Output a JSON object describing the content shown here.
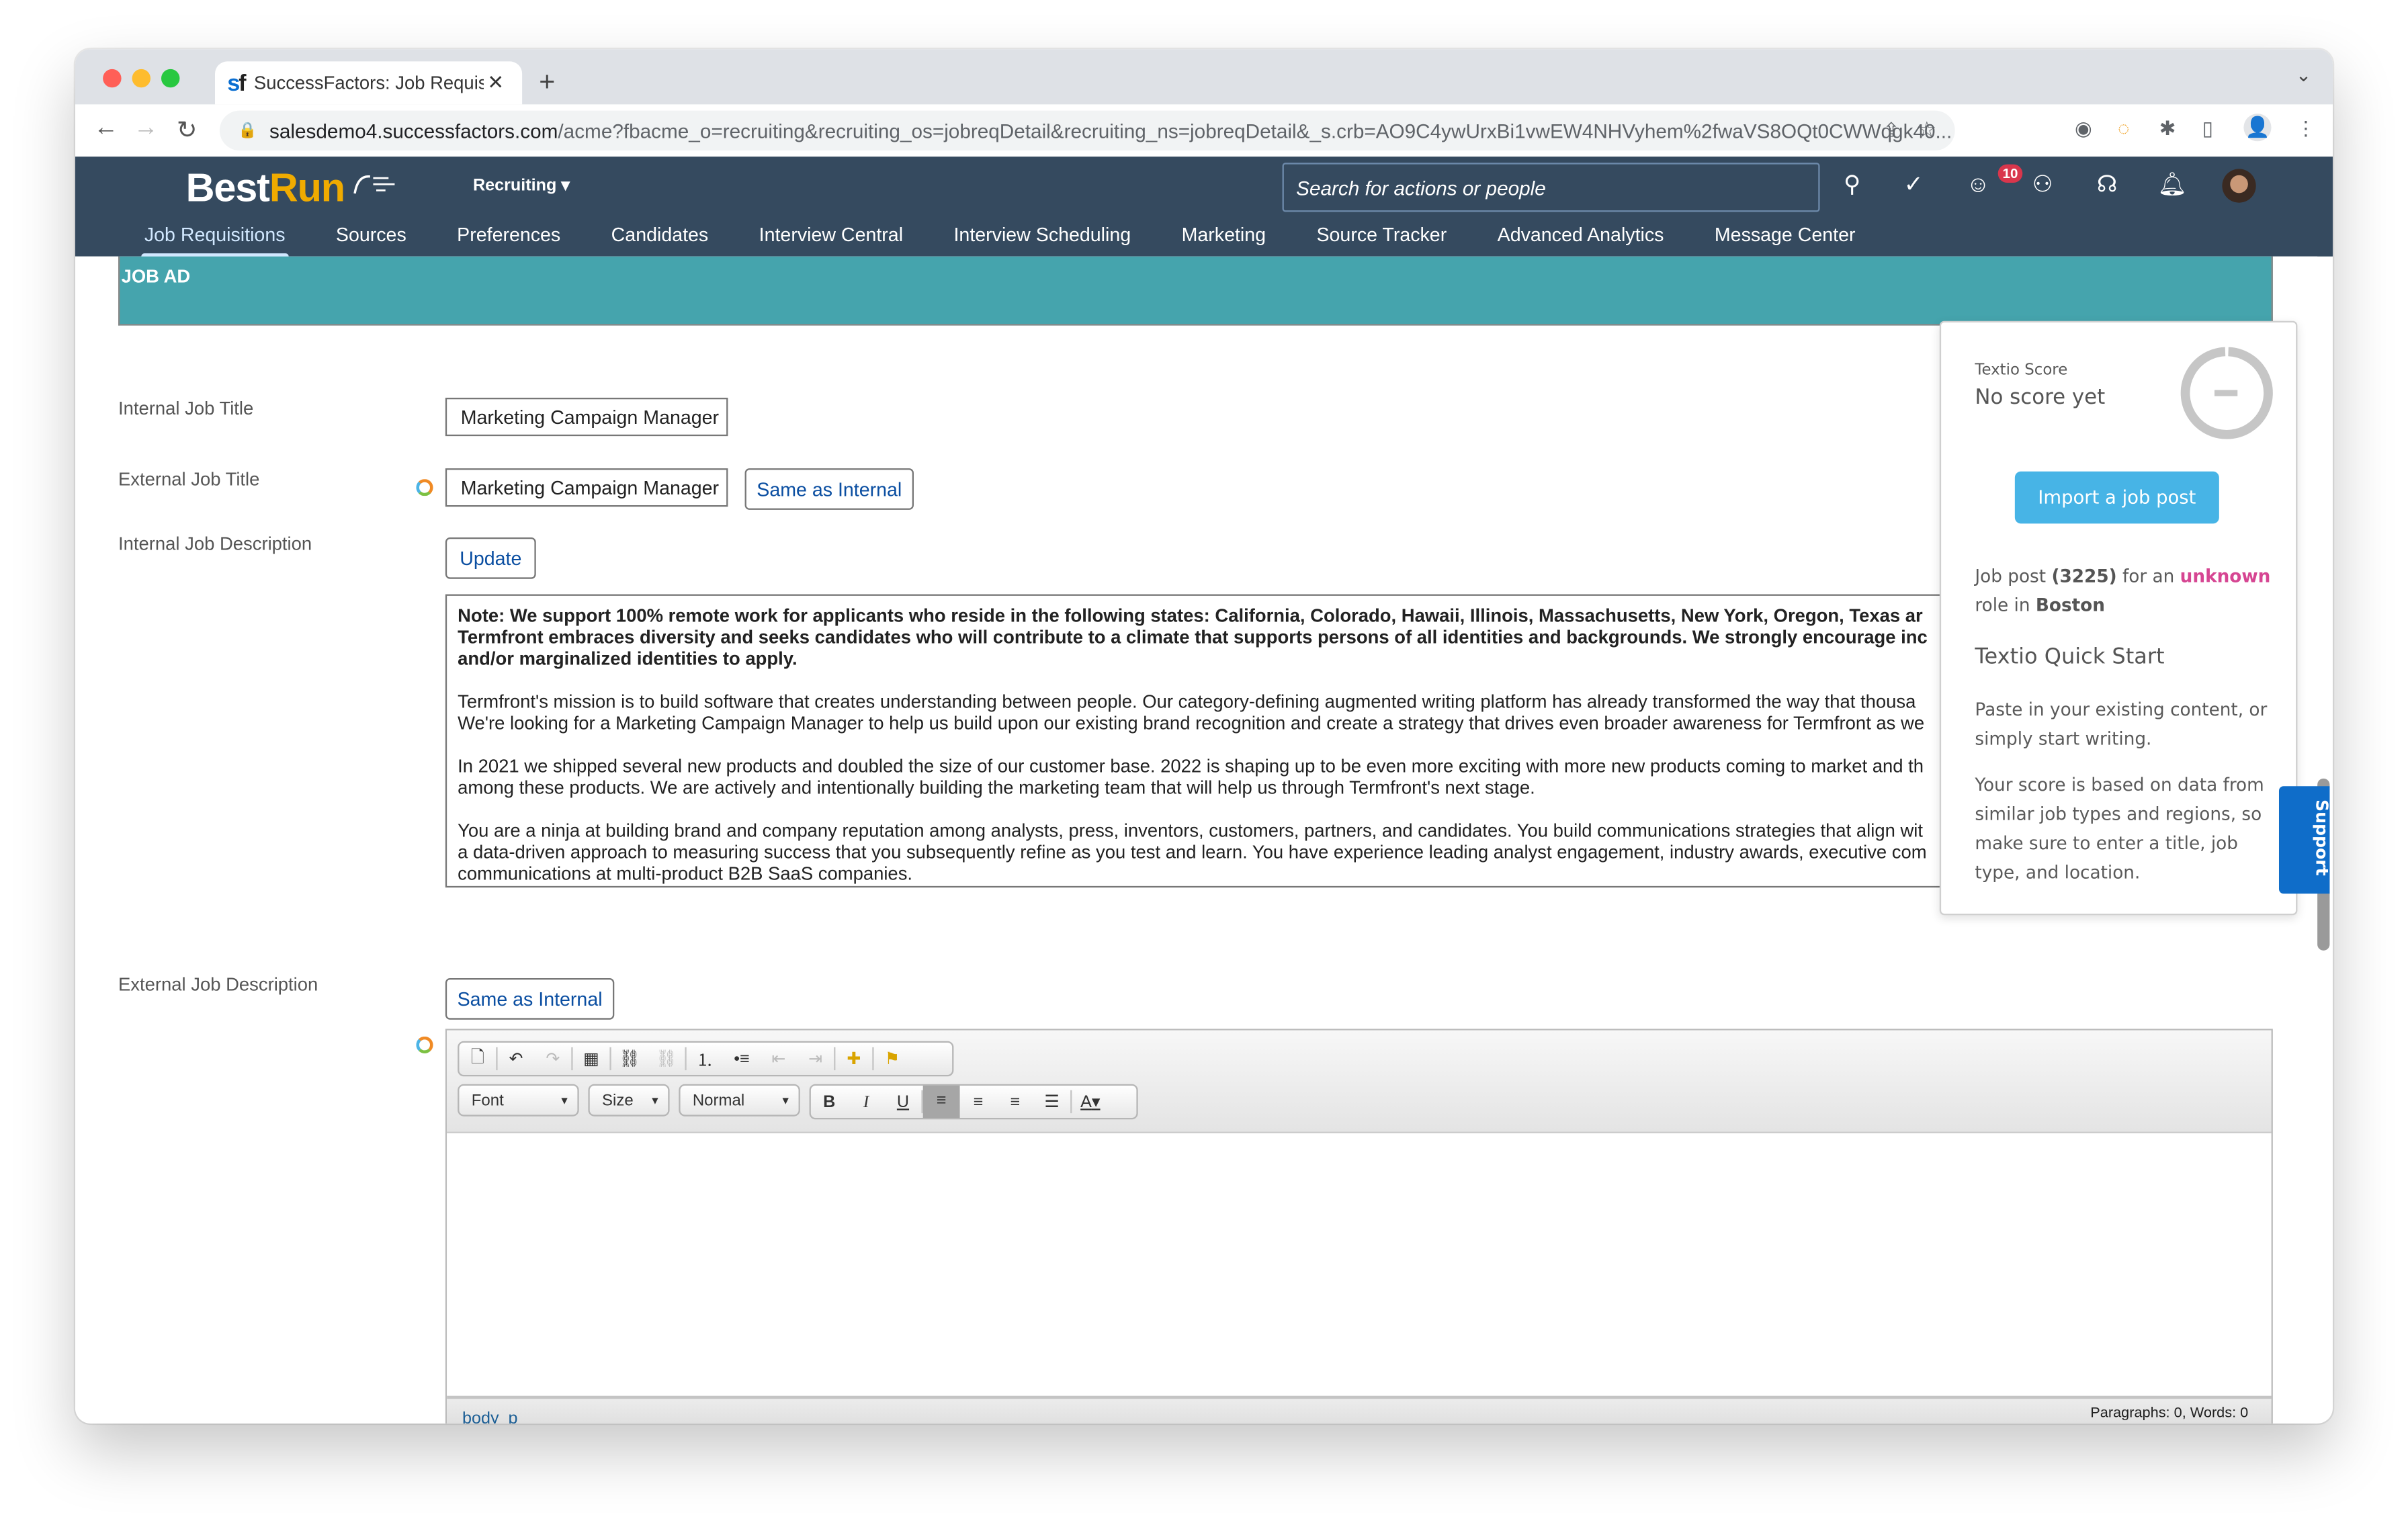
{
  "browser": {
    "tab_title": "SuccessFactors: Job Requisitio",
    "tab_favicon": "sf",
    "url_host": "salesdemo4.successfactors.com",
    "url_path": "/acme?fbacme_o=recruiting&recruiting_os=jobreqDetail&recruiting_ns=jobreqDetail&_s.crb=AO9C4ywUrxBi1vwEW4NHVyhem%2fwaVS8OQt0CWWqgk40..."
  },
  "header": {
    "logo_main": "Best",
    "logo_accent": "Run",
    "module": "Recruiting",
    "search_placeholder": "Search for actions or people",
    "todo_badge": "10",
    "nav": [
      "Job Requisitions",
      "Sources",
      "Preferences",
      "Candidates",
      "Interview Central",
      "Interview Scheduling",
      "Marketing",
      "Source Tracker",
      "Advanced Analytics",
      "Message Center"
    ],
    "active_nav": "Job Requisitions"
  },
  "section": {
    "title": "JOB AD"
  },
  "form": {
    "internal_title_label": "Internal Job Title",
    "internal_title_value": "Marketing Campaign Manager",
    "external_title_label": "External Job Title",
    "external_title_value": "Marketing Campaign Manager",
    "same_as_internal": "Same as Internal",
    "internal_desc_label": "Internal Job Description",
    "update": "Update",
    "internal_desc_paragraphs": [
      {
        "bold": true,
        "lines": [
          "Note: We support 100% remote work for applicants who reside in the following states: California, Colorado, Hawaii, Illinois, Massachusetts, New York, Oregon, Texas ar",
          "Termfront embraces diversity and seeks candidates who will contribute to a climate that supports persons of all identities and backgrounds. We strongly encourage inc",
          "and/or marginalized identities to apply."
        ]
      },
      {
        "bold": false,
        "lines": [
          "Termfront's mission is to build software that creates understanding between people. Our category-defining augmented writing platform has already transformed the way that thousa",
          "We're looking for a Marketing Campaign Manager to help us build upon our existing brand recognition and create a strategy that drives even broader awareness for Termfront as we"
        ]
      },
      {
        "bold": false,
        "lines": [
          "In 2021 we shipped several new products and doubled the size of our customer base. 2022 is shaping up to be even more exciting with more new products coming to market and th",
          "among these products. We are actively and intentionally building the marketing team that will help us through Termfront's next stage."
        ]
      },
      {
        "bold": false,
        "lines": [
          "You are a ninja at building brand and company reputation among analysts, press, inventors, customers, partners, and candidates. You build communications strategies that align wit",
          "a data-driven approach to measuring success that you subsequently refine as you test and learn. You have experience leading analyst engagement, industry awards, executive com",
          "communications at multi-product B2B SaaS companies."
        ]
      }
    ],
    "external_desc_label": "External Job Description",
    "external_same_as_internal": "Same as Internal"
  },
  "editor": {
    "font_combo": "Font",
    "size_combo": "Size",
    "format_combo": "Normal",
    "bold": "B",
    "italic": "I",
    "underline": "U",
    "text_color": "A",
    "path": [
      "body",
      "p"
    ],
    "status": "Paragraphs: 0, Words: 0",
    "content": ""
  },
  "textio": {
    "score_label": "Textio Score",
    "score_value": "No score yet",
    "import_button": "Import a job post",
    "info_prefix": "Job post",
    "info_count": "(3225)",
    "info_mid": "for an",
    "info_role": "unknown",
    "info_role_suffix": "role in",
    "info_location": "Boston",
    "quick_start_title": "Textio Quick Start",
    "quick_start_p1": "Paste in your existing content, or simply start writing.",
    "quick_start_p2": "Your score is based on data from similar job types and regions, so make sure to enter a title, job type, and location.",
    "accent_color": "#47b4e6",
    "role_color": "#d64592"
  },
  "support_tab": "Support",
  "colors": {
    "header_bg": "#354a5f",
    "section_bg": "#45a4ad",
    "link": "#0a4ea1",
    "support": "#0f6dc9"
  }
}
